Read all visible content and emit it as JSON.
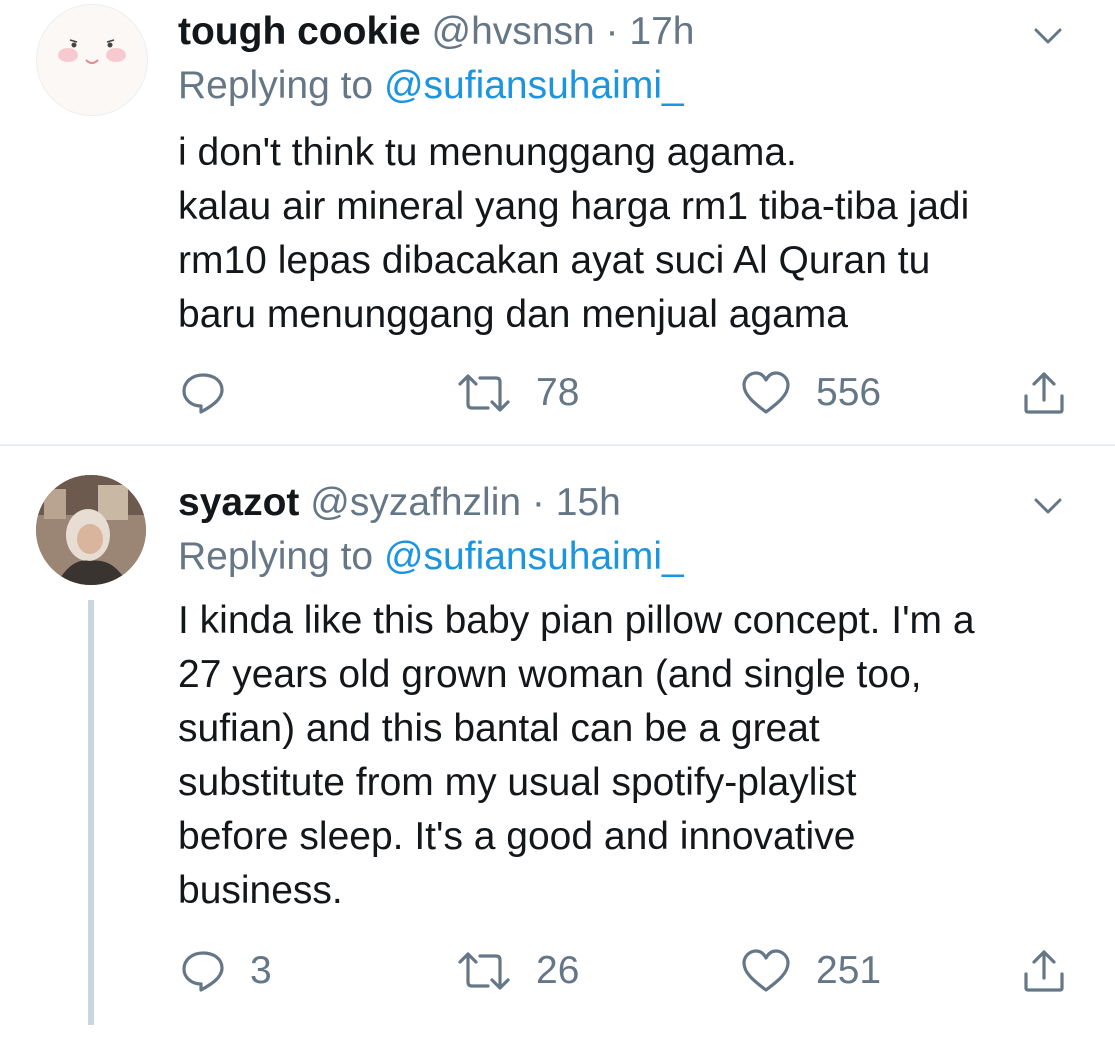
{
  "tweets": [
    {
      "name": "tough cookie",
      "handle": "@hvsnsn",
      "sep": "·",
      "time": "17h",
      "replying_prefix": "Replying to ",
      "replying_to": "@sufiansuhaimi_",
      "lines": [
        "i don't think tu menunggang agama.",
        "kalau air mineral yang harga rm1 tiba-tiba jadi",
        "rm10 lepas dibacakan ayat suci Al Quran tu",
        "baru menunggang dan menjual agama"
      ],
      "reply_count": "",
      "retweet_count": "78",
      "like_count": "556"
    },
    {
      "name": "syazot",
      "handle": "@syzafhzlin",
      "sep": "·",
      "time": "15h",
      "replying_prefix": "Replying to ",
      "replying_to": "@sufiansuhaimi_",
      "lines": [
        "I kinda like this baby pian pillow concept. I'm a",
        "27 years old grown woman (and single too,",
        "sufian) and this bantal can be a great",
        "substitute from my usual spotify-playlist",
        "before sleep. It's a good and innovative",
        "business."
      ],
      "reply_count": "3",
      "retweet_count": "26",
      "like_count": "251"
    }
  ],
  "icons": {
    "reply": "reply-icon",
    "retweet": "retweet-icon",
    "like": "heart-icon",
    "share": "share-icon",
    "more": "chevron-down-icon"
  },
  "colors": {
    "text": "#14171a",
    "secondary": "#657786",
    "link": "#1b95e0",
    "divider": "#e6ecf0",
    "thread_line": "#ccd6dd"
  }
}
